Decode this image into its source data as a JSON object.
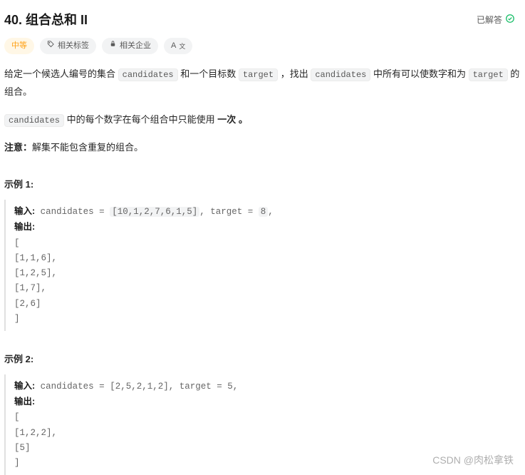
{
  "header": {
    "title": "40. 组合总和 II",
    "solved_label": "已解答"
  },
  "tags": {
    "difficulty": "中等",
    "related_tags": "相关标签",
    "related_companies": "相关企业",
    "font_icon": "A"
  },
  "desc": {
    "p1_a": "给定一个候选人编号的集合 ",
    "p1_code1": "candidates",
    "p1_b": " 和一个目标数 ",
    "p1_code2": "target",
    "p1_c": " ，找出 ",
    "p1_code3": "candidates",
    "p1_d": " 中所有可以使数字和为 ",
    "p1_code4": "target",
    "p1_e": " 的组合。",
    "p2_code": "candidates",
    "p2_a": " 中的每个数字在每个组合中只能使用 ",
    "p2_strong": "一次 。",
    "p3_strong": "注意：",
    "p3_a": "解集不能包含重复的组合。 "
  },
  "example1": {
    "title": "示例 1:",
    "in_label": "输入:",
    "in_a": " candidates = ",
    "in_hl": "[10,1,2,7,6,1,5]",
    "in_b": ", target = ",
    "in_c": "8",
    "in_d": ",",
    "out_label": "输出:",
    "out_lines": "[\n[1,1,6],\n[1,2,5],\n[1,7],\n[2,6]\n]"
  },
  "example2": {
    "title": "示例 2:",
    "in_label": "输入:",
    "in_a": " candidates = [2,5,2,1,2], target = 5,",
    "out_label": "输出:",
    "out_lines": "[\n[1,2,2],\n[5]\n]"
  },
  "watermark": "CSDN @肉松拿铁"
}
